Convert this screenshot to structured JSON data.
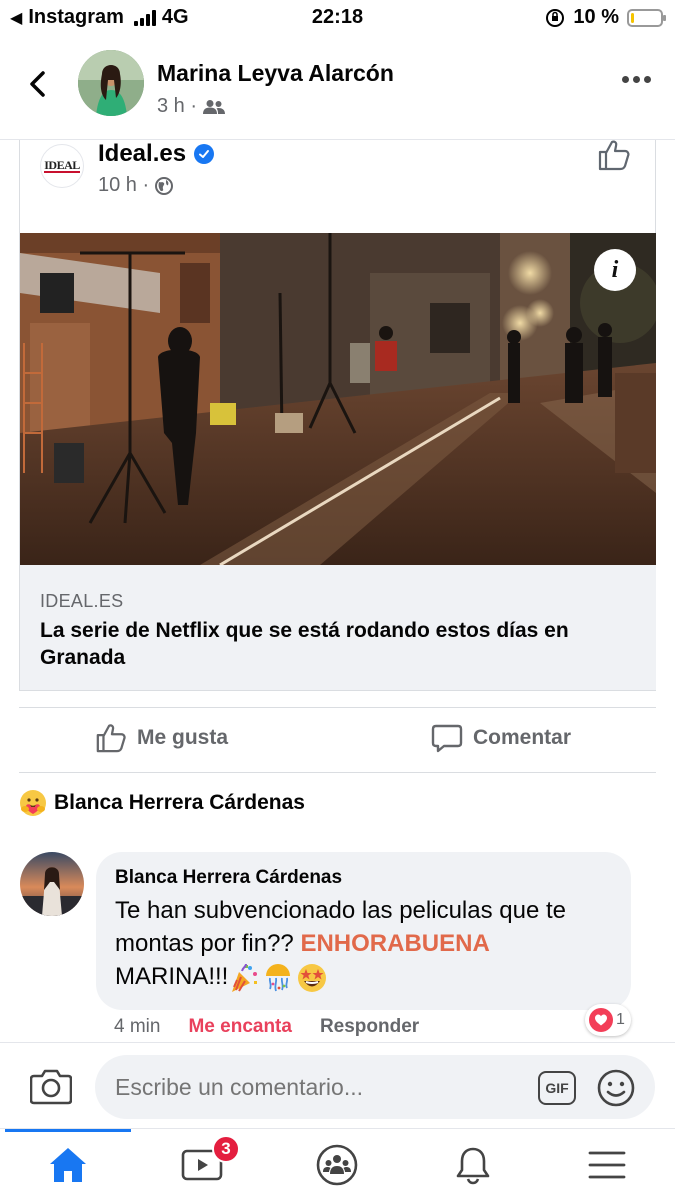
{
  "status_bar": {
    "carrier_app": "Instagram",
    "network": "4G",
    "time": "22:18",
    "battery_percent": "10 %",
    "battery_level": 0.1
  },
  "header": {
    "author_name": "Marina Leyva Alarcón",
    "time_ago": "3 h ·",
    "audience_icon": "friends-icon"
  },
  "shared_post": {
    "page_name": "Ideal.es",
    "page_logo_text": "IDEAL",
    "time_ago": "10 h ·",
    "audience_icon": "globe-icon",
    "link": {
      "domain": "IDEAL.ES",
      "title": "La serie de Netflix que se está rodando estos días en Granada"
    }
  },
  "actions": {
    "like_label": "Me gusta",
    "comment_label": "Comentar"
  },
  "reactor": {
    "name": "Blanca Herrera Cárdenas"
  },
  "comment": {
    "author": "Blanca Herrera Cárdenas",
    "text_before": "Te han subvencionado las peliculas que te montas por fin?? ",
    "highlight": "ENHORABUENA",
    "text_after": " MARINA!!!",
    "time": "4 min",
    "love_label": "Me encanta",
    "reply_label": "Responder",
    "reaction_count": "1"
  },
  "composer": {
    "placeholder": "Escribe un comentario...",
    "gif_label": "GIF"
  },
  "tab_bar": {
    "video_badge": "3",
    "icons": [
      "home-icon",
      "video-icon",
      "groups-icon",
      "bell-icon",
      "menu-icon"
    ]
  },
  "colors": {
    "accent": "#1877f2",
    "love": "#e9415c",
    "highlight": "#e1694a",
    "badge": "#e41e3f"
  }
}
